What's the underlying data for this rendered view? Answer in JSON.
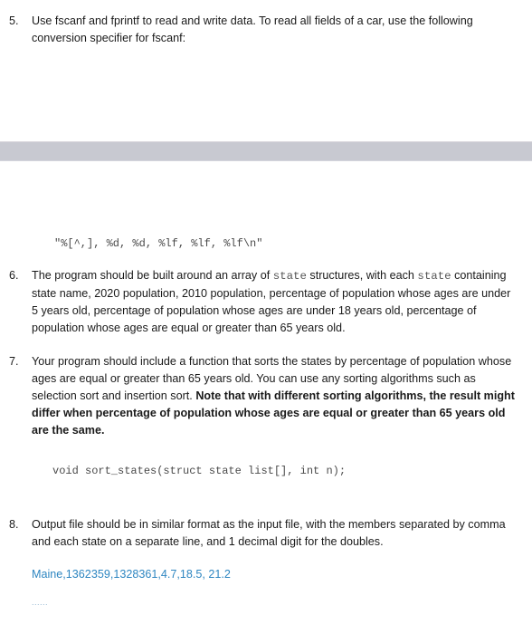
{
  "items": [
    {
      "number": "5.",
      "text": "Use fscanf and fprintf to read and write data. To read all fields of a car, use the following conversion specifier for fscanf:"
    },
    {
      "number": "6.",
      "text_before": "The program should be built around an array of ",
      "code1": "state",
      "text_middle": " structures, with each ",
      "code2": "state",
      "text_after": " containing state name, 2020 population, 2010 population, percentage of population whose ages are under 5 years old, percentage of population whose ages are under 18 years old, percentage of population whose ages are equal or greater than 65 years old."
    },
    {
      "number": "7.",
      "text_normal": "Your program should include a function that sorts the states by percentage of population whose ages are equal or greater than 65 years old. You can use any sorting algorithms such as selection sort and insertion sort. ",
      "text_bold": "Note that with different sorting algorithms, the result might differ when percentage of population whose ages are equal or greater than 65 years old are the same."
    },
    {
      "number": "8.",
      "text": "Output file should be in similar format as the input file, with the members separated by comma and each state on a separate line, and 1 decimal digit for the doubles."
    }
  ],
  "format_specifier": "\"%[^,], %d, %d, %lf, %lf, %lf\\n\"",
  "function_prototype": "void sort_states(struct state list[], int n);",
  "example_output": "Maine,1362359,1328361,4.7,18.5, 21.2",
  "ellipsis": "......",
  "colors": {
    "example_text": "#2e86c1",
    "gray_band": "#c8c9d1"
  }
}
